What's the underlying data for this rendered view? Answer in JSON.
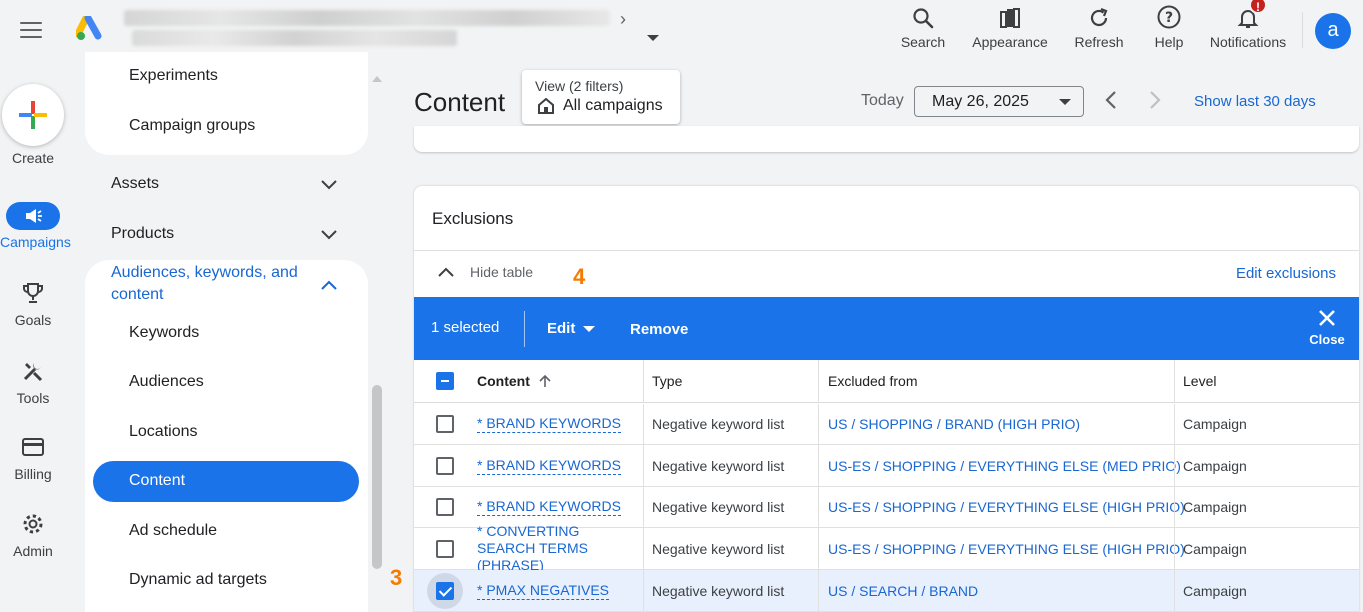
{
  "header": {
    "tools": [
      {
        "label": "Search",
        "icon": "search-icon"
      },
      {
        "label": "Appearance",
        "icon": "appearance-icon"
      },
      {
        "label": "Refresh",
        "icon": "refresh-icon"
      },
      {
        "label": "Help",
        "icon": "help-icon"
      },
      {
        "label": "Notifications",
        "icon": "bell-icon"
      }
    ],
    "notification_badge": "!",
    "avatar_letter": "a"
  },
  "rail": {
    "create": "Create",
    "items": [
      {
        "label": "Campaigns",
        "icon": "megaphone-icon"
      },
      {
        "label": "Goals",
        "icon": "trophy-icon"
      },
      {
        "label": "Tools",
        "icon": "tools-icon"
      },
      {
        "label": "Billing",
        "icon": "credit-card-icon"
      },
      {
        "label": "Admin",
        "icon": "gear-icon"
      }
    ]
  },
  "nav": {
    "experiments": "Experiments",
    "campaign_groups": "Campaign groups",
    "assets": "Assets",
    "products": "Products",
    "audiences_section": "Audiences, keywords, and content",
    "keywords": "Keywords",
    "audiences": "Audiences",
    "locations": "Locations",
    "content": "Content",
    "ad_schedule": "Ad schedule",
    "dynamic_ad_targets": "Dynamic ad targets"
  },
  "annotations": {
    "step3": "3",
    "step4": "4"
  },
  "main": {
    "title": "Content",
    "filter_view": "View (2 filters)",
    "filter_value": "All campaigns",
    "today": "Today",
    "date": "May 26, 2025",
    "show_last": "Show last 30 days"
  },
  "exclusions": {
    "title": "Exclusions",
    "hide_table": "Hide table",
    "edit_exclusions": "Edit exclusions",
    "selection": {
      "count": "1 selected",
      "edit": "Edit",
      "remove": "Remove",
      "close": "Close"
    },
    "columns": {
      "content": "Content",
      "type": "Type",
      "excluded_from": "Excluded from",
      "level": "Level"
    },
    "rows": [
      {
        "content": "* BRAND KEYWORDS",
        "type": "Negative keyword list",
        "excluded_from": "US / SHOPPING / BRAND (HIGH PRIO)",
        "level": "Campaign",
        "checked": false
      },
      {
        "content": "* BRAND KEYWORDS",
        "type": "Negative keyword list",
        "excluded_from": "US-ES / SHOPPING / EVERYTHING ELSE (MED PRIO)",
        "level": "Campaign",
        "checked": false
      },
      {
        "content": "* BRAND KEYWORDS",
        "type": "Negative keyword list",
        "excluded_from": "US-ES / SHOPPING / EVERYTHING ELSE (HIGH PRIO)",
        "level": "Campaign",
        "checked": false
      },
      {
        "content": "* CONVERTING SEARCH TERMS (PHRASE)",
        "type": "Negative keyword list",
        "excluded_from": "US-ES / SHOPPING / EVERYTHING ELSE (HIGH PRIO)",
        "level": "Campaign",
        "checked": false
      },
      {
        "content": "* PMAX NEGATIVES",
        "type": "Negative keyword list",
        "excluded_from": "US / SEARCH / BRAND",
        "level": "Campaign",
        "checked": true
      }
    ]
  },
  "colors": {
    "accent": "#1a73e8",
    "link": "#1967d2",
    "annotation": "#f57c00",
    "badge": "#c5221f"
  }
}
